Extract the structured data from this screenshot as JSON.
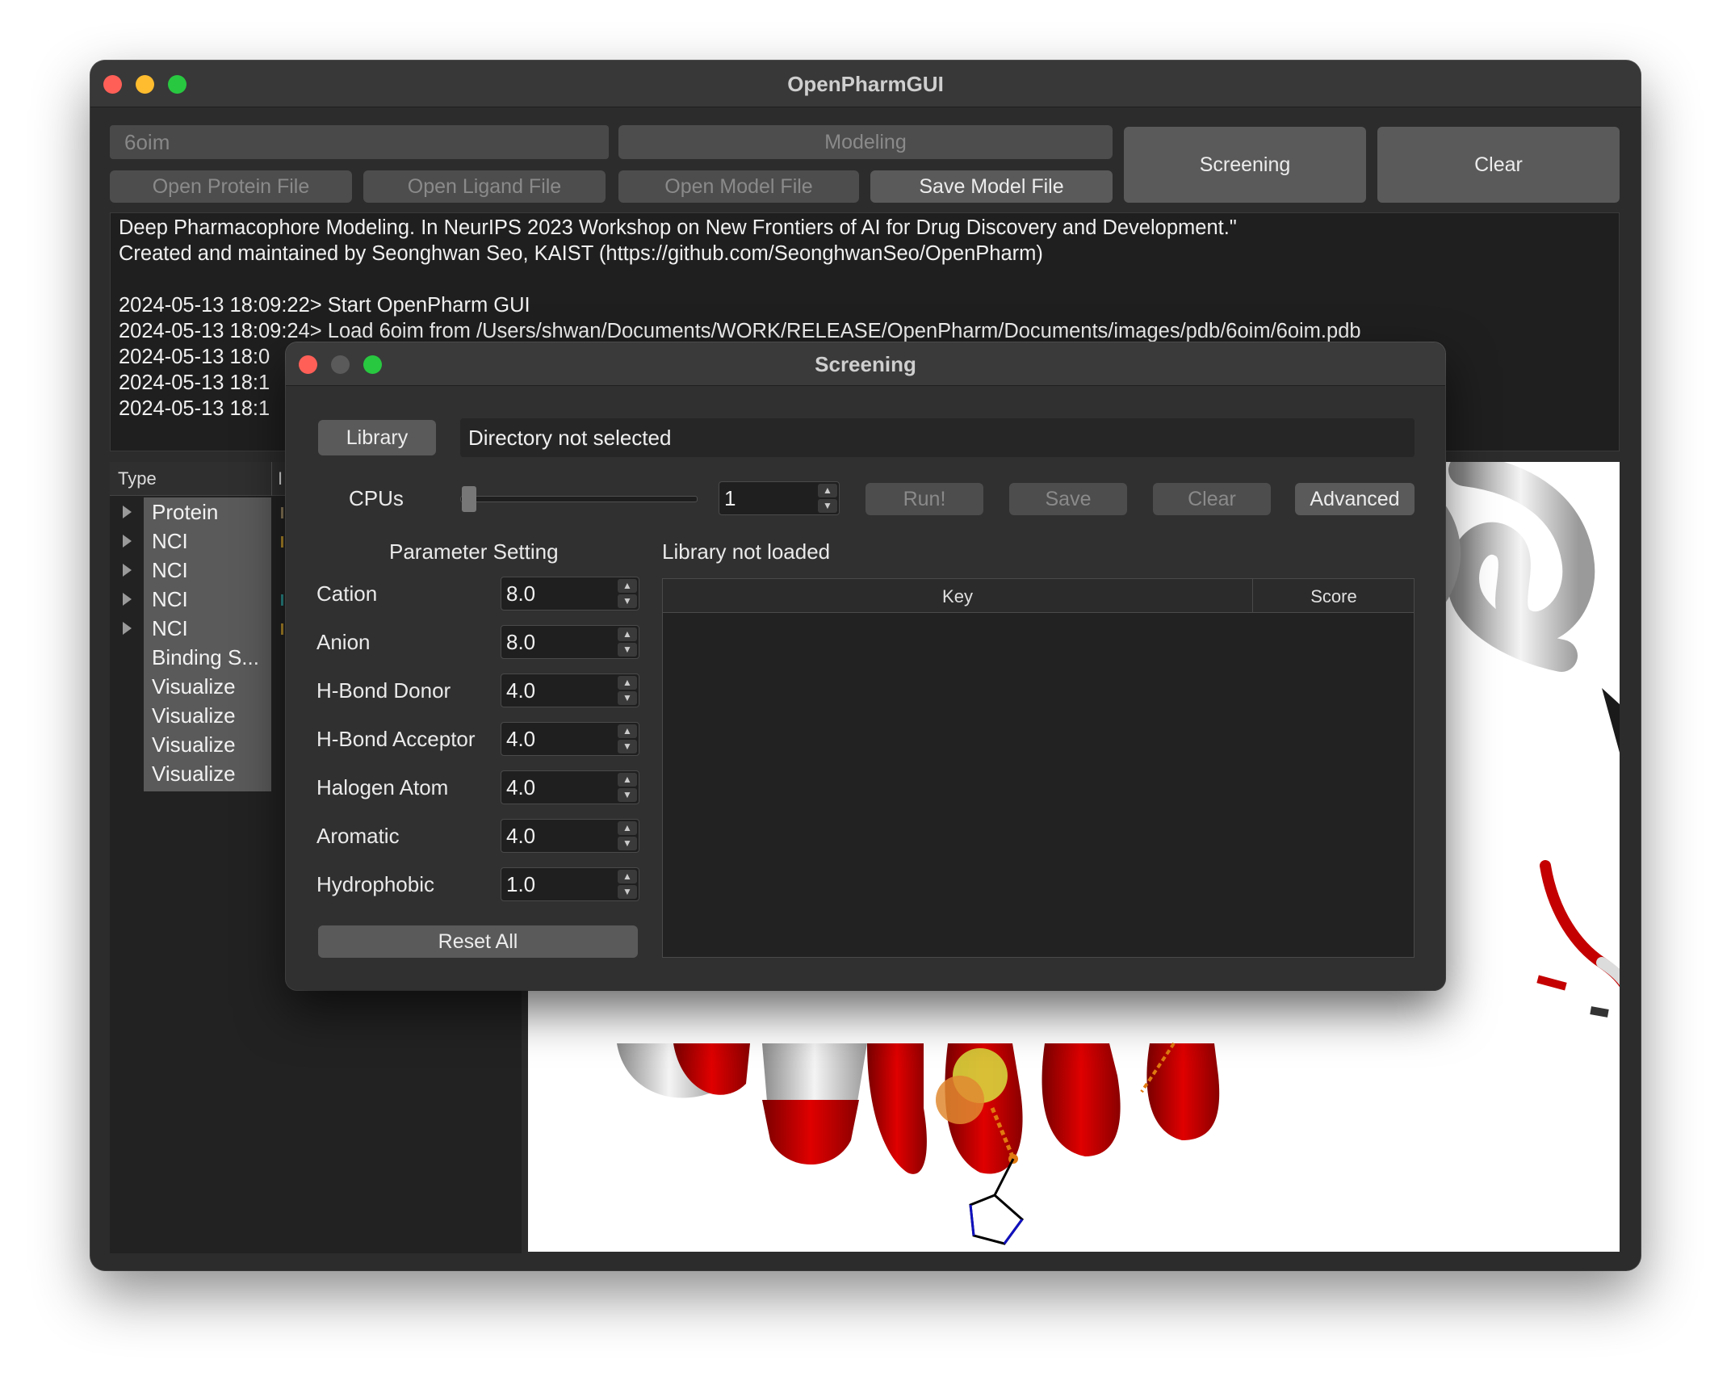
{
  "window": {
    "title": "OpenPharmGUI"
  },
  "toolbar": {
    "pdb_field_value": "6oim",
    "modeling_label": "Modeling",
    "open_protein_label": "Open Protein File",
    "open_ligand_label": "Open Ligand File",
    "open_model_label": "Open Model File",
    "save_model_label": "Save Model File",
    "screening_label": "Screening",
    "clear_label": "Clear"
  },
  "log": {
    "lines": [
      "Deep Pharmacophore Modeling. In NeurIPS 2023 Workshop on New Frontiers of AI for Drug Discovery and Development.\"",
      "Created and maintained by Seonghwan Seo, KAIST (https://github.com/SeonghwanSeo/OpenPharm)",
      "",
      "2024-05-13 18:09:22> Start OpenPharm GUI",
      "2024-05-13 18:09:24> Load 6oim from /Users/shwan/Documents/WORK/RELEASE/OpenPharm/Documents/images/pdb/6oim/6oim.pdb",
      "2024-05-13 18:0",
      "2024-05-13 18:1",
      "2024-05-13 18:1"
    ]
  },
  "tree": {
    "header_type": "Type",
    "header_col2": "I",
    "items": [
      {
        "label": "Protein",
        "expandable": true
      },
      {
        "label": "NCI",
        "expandable": true
      },
      {
        "label": "NCI",
        "expandable": true
      },
      {
        "label": "NCI",
        "expandable": true
      },
      {
        "label": "NCI",
        "expandable": true
      },
      {
        "label": "Binding S...",
        "expandable": false
      },
      {
        "label": "Visualize",
        "expandable": false
      },
      {
        "label": "Visualize",
        "expandable": false
      },
      {
        "label": "Visualize",
        "expandable": false
      },
      {
        "label": "Visualize",
        "expandable": false
      }
    ]
  },
  "dialog": {
    "title": "Screening",
    "library_label": "Library",
    "directory_status": "Directory not selected",
    "cpus_label": "CPUs",
    "cpus_value": "1",
    "run_label": "Run!",
    "save_label": "Save",
    "clear_label": "Clear",
    "advanced_label": "Advanced",
    "parameter_heading": "Parameter Setting",
    "library_status": "Library not loaded",
    "params": [
      {
        "label": "Cation",
        "value": "8.0"
      },
      {
        "label": "Anion",
        "value": "8.0"
      },
      {
        "label": "H-Bond Donor",
        "value": "4.0"
      },
      {
        "label": "H-Bond Acceptor",
        "value": "4.0"
      },
      {
        "label": "Halogen Atom",
        "value": "4.0"
      },
      {
        "label": "Aromatic",
        "value": "4.0"
      },
      {
        "label": "Hydrophobic",
        "value": "1.0"
      }
    ],
    "reset_label": "Reset All",
    "table": {
      "columns": [
        "Key",
        "Score"
      ]
    }
  },
  "colors": {
    "close": "#ff5f57",
    "minimize": "#febc2e",
    "zoom": "#28c840",
    "helix_red": "#d40000",
    "helix_white": "#e6e6e6"
  }
}
